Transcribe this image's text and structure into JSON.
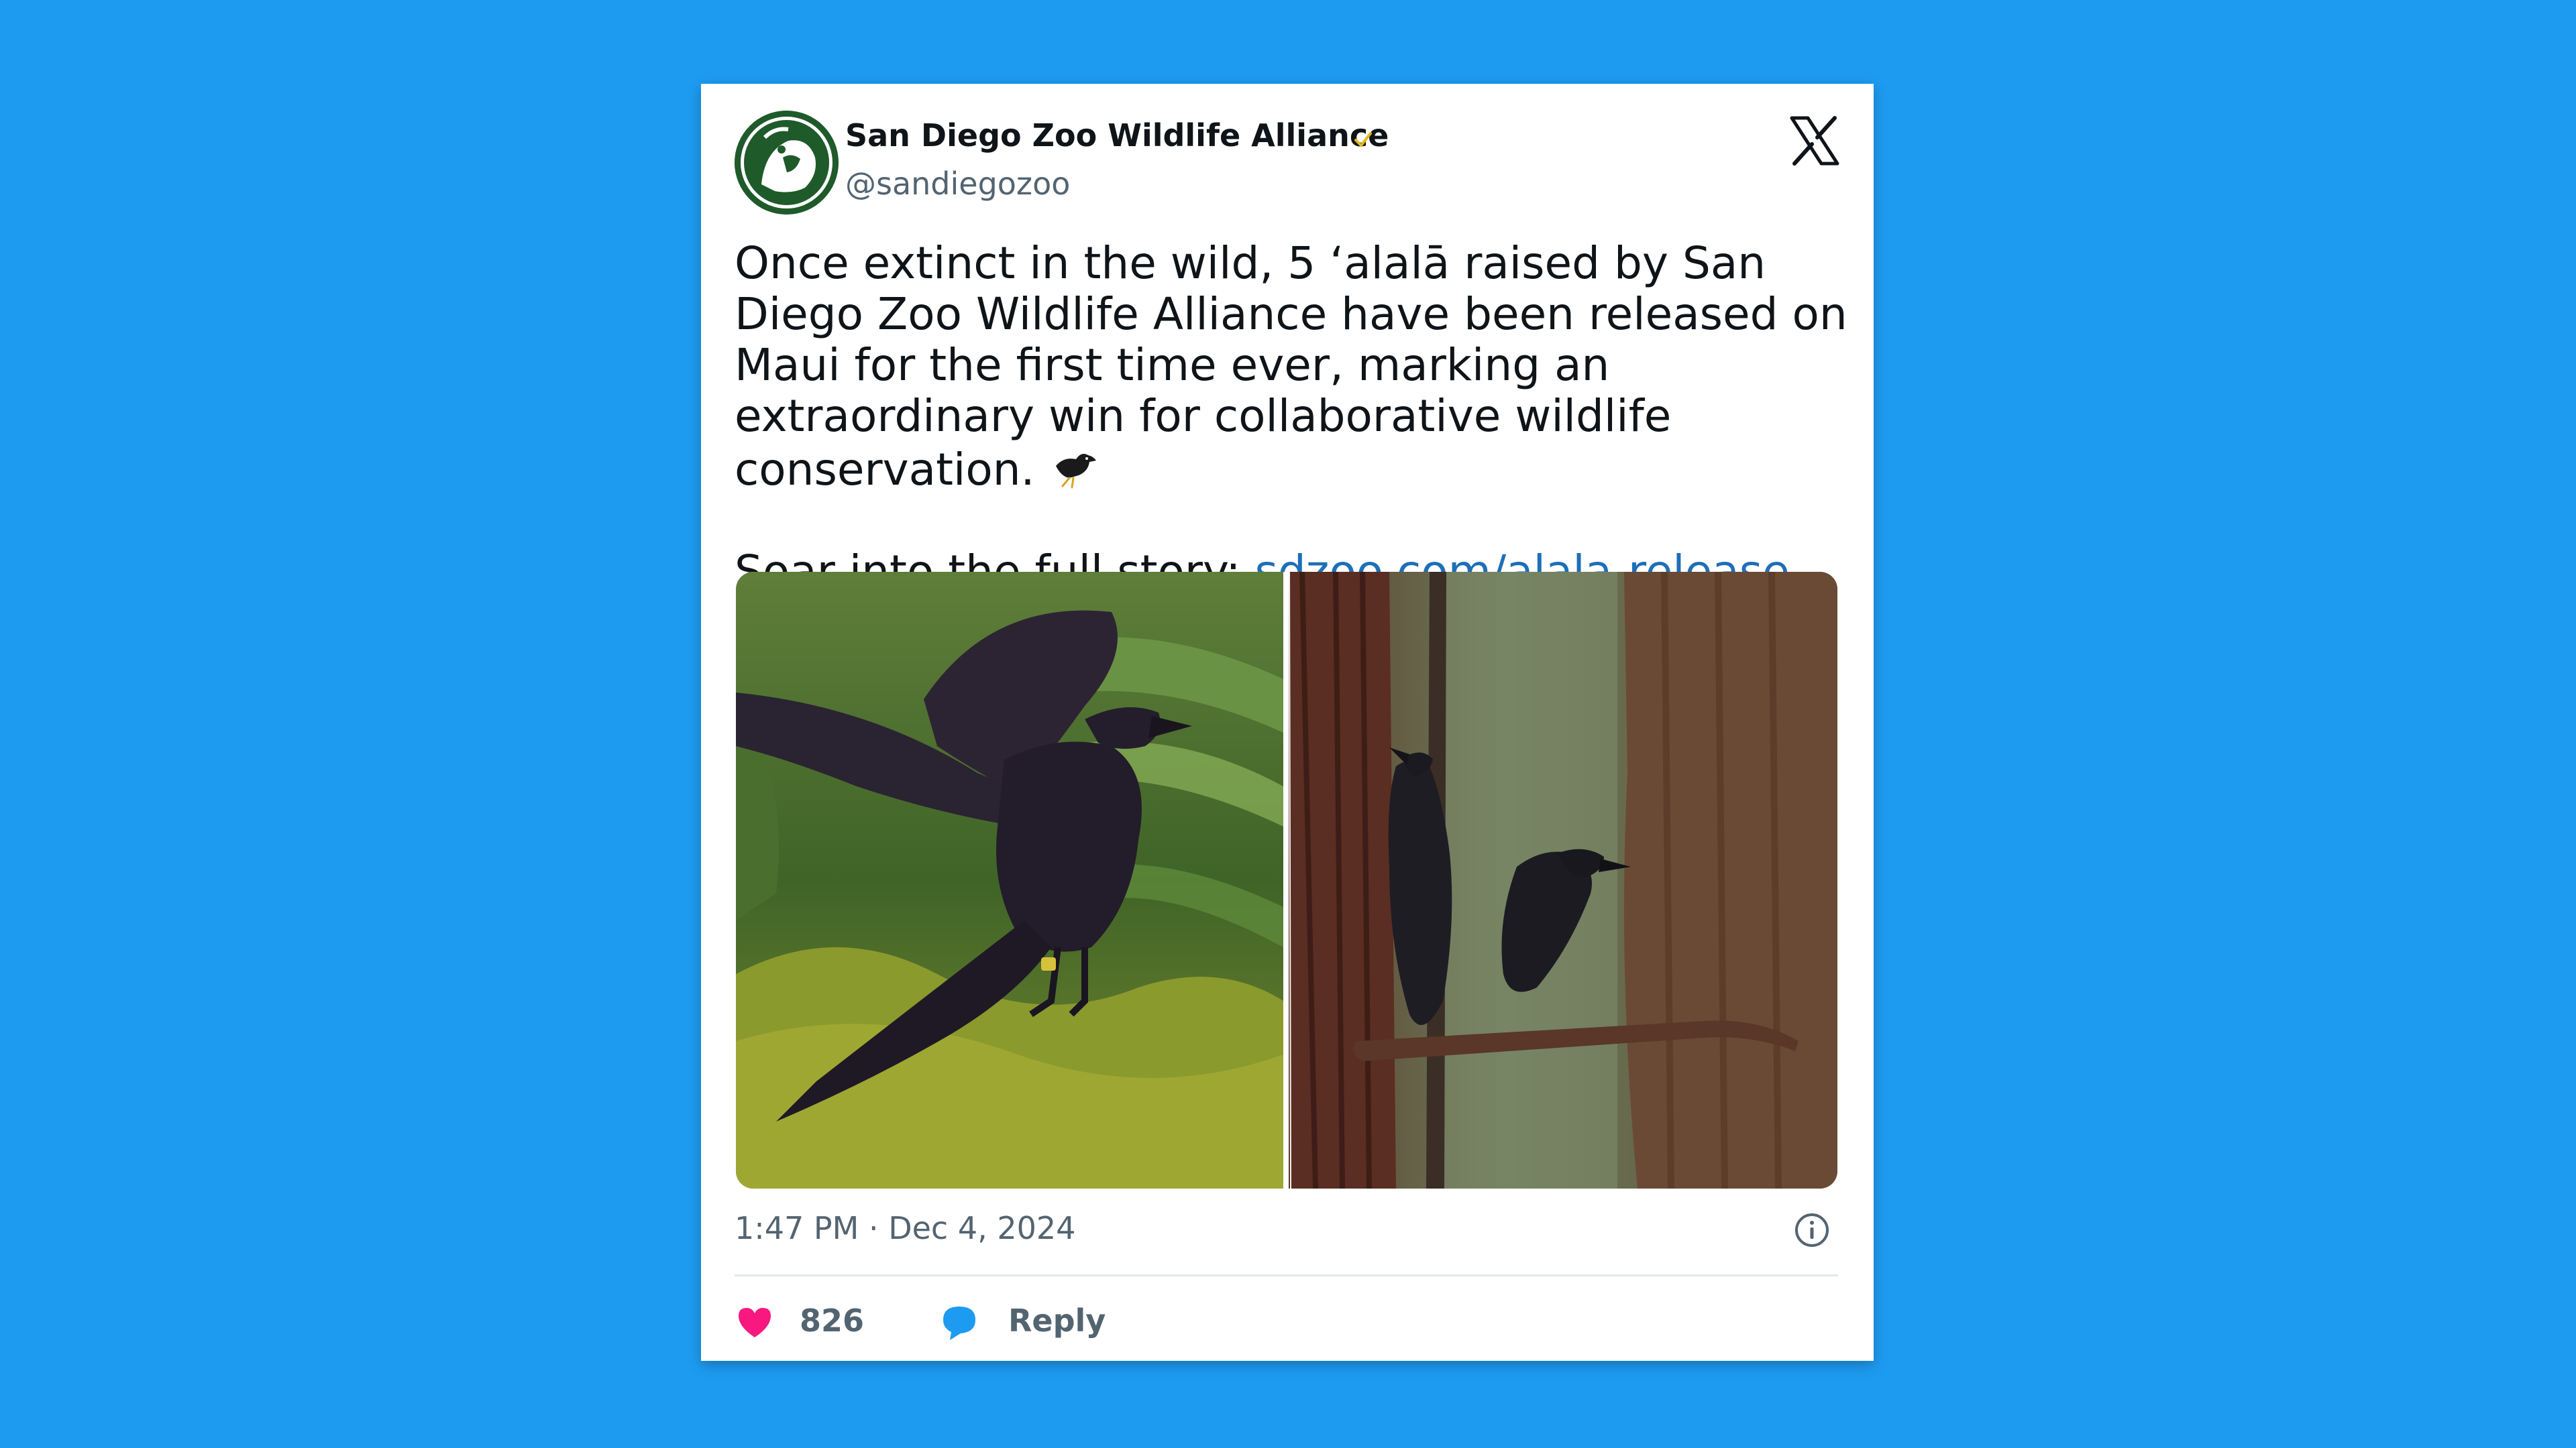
{
  "tweet": {
    "author_name": "San Diego Zoo Wildlife Alliance",
    "author_handle": "@sandiegozoo",
    "text_line1": "Once extinct in the wild, 5 ‘alalā raised by San Diego Zoo Wildlife Alliance have been released on Maui for the first time ever, marking an extraordinary win for collaborative wildlife conservation.",
    "text_line2_prefix": "Soar into the full story: ",
    "link_text": "sdzoo.com/alala-release",
    "timestamp": "1:47 PM · Dec 4, 2024",
    "like_count": "826",
    "reply_label": "Reply",
    "images": [
      {
        "depicts": "black ‘alalā crow with spread wings among green ferns"
      },
      {
        "depicts": "two black ‘alalā crows perched on a branch beside a tree trunk"
      }
    ]
  },
  "icons": {
    "verified": "verified-badge-icon",
    "brand": "x-logo-icon",
    "info": "info-icon",
    "like": "heart-icon",
    "reply": "reply-bubble-icon",
    "emoji": "black-bird-emoji"
  },
  "colors": {
    "background": "#1d9bf0",
    "link": "#1d6fb8",
    "heart": "#f91880",
    "reply": "#1d9bf0",
    "verified": "#e2b719"
  }
}
